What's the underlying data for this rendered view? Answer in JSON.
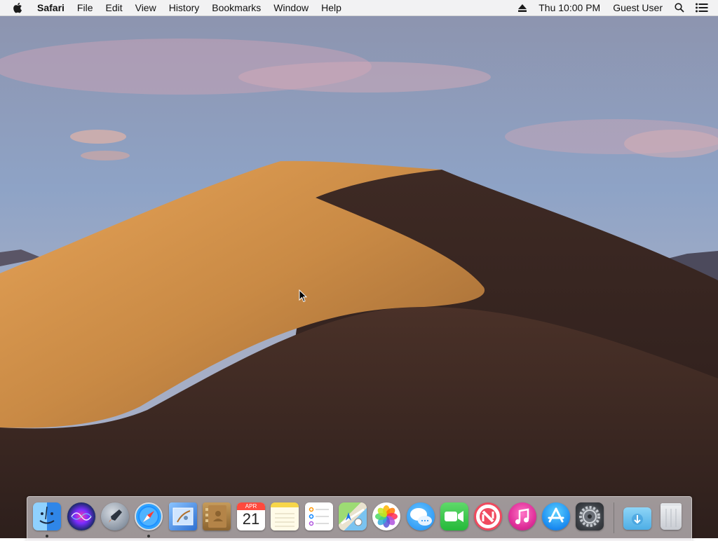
{
  "menubar": {
    "apple_icon": "apple-logo-icon",
    "app_name": "Safari",
    "menus": [
      "File",
      "Edit",
      "View",
      "History",
      "Bookmarks",
      "Window",
      "Help"
    ],
    "status": {
      "eject_icon": "eject-icon",
      "clock": "Thu 10:00 PM",
      "user": "Guest User",
      "spotlight_icon": "search-icon",
      "notification_icon": "notification-center-icon"
    }
  },
  "desktop": {
    "wallpaper": "desert-dune-wallpaper"
  },
  "dock": {
    "apps": [
      {
        "name": "Finder",
        "icon": "finder-icon",
        "running": true
      },
      {
        "name": "Siri",
        "icon": "siri-icon",
        "running": false
      },
      {
        "name": "Launchpad",
        "icon": "launchpad-icon",
        "running": false
      },
      {
        "name": "Safari",
        "icon": "safari-icon",
        "running": true
      },
      {
        "name": "Mail",
        "icon": "mail-icon",
        "running": false
      },
      {
        "name": "Contacts",
        "icon": "contacts-icon",
        "running": false
      },
      {
        "name": "Calendar",
        "icon": "calendar-icon",
        "running": false,
        "month": "APR",
        "day": "21"
      },
      {
        "name": "Notes",
        "icon": "notes-icon",
        "running": false
      },
      {
        "name": "Reminders",
        "icon": "reminders-icon",
        "running": false
      },
      {
        "name": "Maps",
        "icon": "maps-icon",
        "running": false
      },
      {
        "name": "Photos",
        "icon": "photos-icon",
        "running": false
      },
      {
        "name": "Messages",
        "icon": "messages-icon",
        "running": false
      },
      {
        "name": "FaceTime",
        "icon": "facetime-icon",
        "running": false
      },
      {
        "name": "News",
        "icon": "news-icon",
        "running": false
      },
      {
        "name": "iTunes",
        "icon": "itunes-icon",
        "running": false
      },
      {
        "name": "App Store",
        "icon": "app-store-icon",
        "running": false
      },
      {
        "name": "System Preferences",
        "icon": "system-preferences-icon",
        "running": false
      }
    ],
    "stacks": [
      {
        "name": "Downloads",
        "icon": "downloads-folder-icon"
      },
      {
        "name": "Trash",
        "icon": "trash-icon"
      }
    ]
  },
  "colors": {
    "menubar_bg": "#f6f6f6",
    "running_indicator": "#333333"
  }
}
